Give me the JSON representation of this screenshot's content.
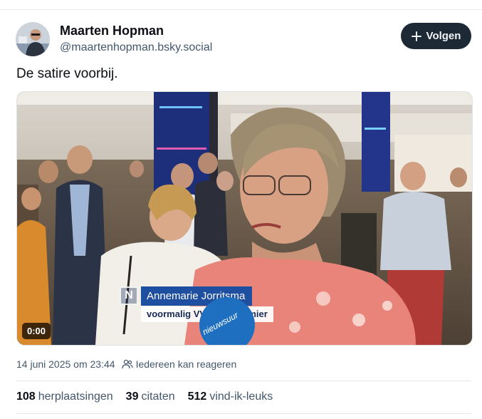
{
  "author": {
    "name": "Maarten Hopman",
    "handle": "@maartenhopman.bsky.social"
  },
  "follow_button": {
    "label": "Volgen",
    "icon": "plus-icon"
  },
  "post": {
    "text": "De satire voorbij.",
    "video": {
      "duration": "0:00",
      "lower_third": {
        "logo": "N",
        "name": "Annemarie Jorritsma",
        "title": "voormalig VVD-vicepremier"
      },
      "watermark": "nieuwsuur"
    },
    "timestamp": "14 juni 2025 om 23:44",
    "reply_setting": "Iedereen kan reageren",
    "reply_setting_icon": "people-icon"
  },
  "stats": {
    "reposts_count": "108",
    "reposts_label": "herplaatsingen",
    "quotes_count": "39",
    "quotes_label": "citaten",
    "likes_count": "512",
    "likes_label": "vind-ik-leuks"
  },
  "colors": {
    "follow_bg": "#1e2936",
    "name_bar": "#1f4fa0",
    "muted_text": "#42576c"
  }
}
